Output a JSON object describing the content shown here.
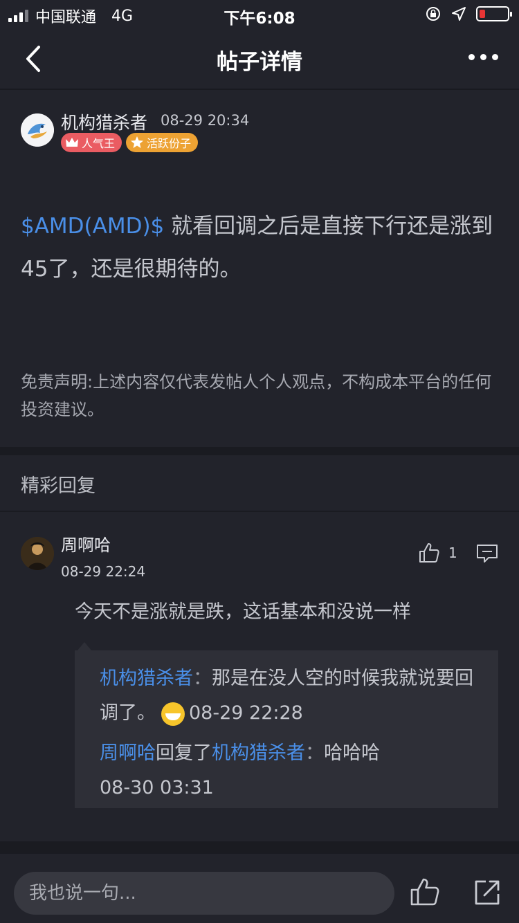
{
  "status_bar": {
    "carrier": "中国联通",
    "network": "4G",
    "time": "下午6:08",
    "battery_level": 0.2
  },
  "nav": {
    "title": "帖子详情"
  },
  "post": {
    "author": "机构猎杀者",
    "time": "08-29 20:34",
    "badges": [
      "人气王",
      "活跃份子"
    ],
    "stock_tag": "$AMD(AMD)$",
    "body": " 就看回调之后是直接下行还是涨到45了，还是很期待的。",
    "disclaimer": "免责声明:上述内容仅代表发帖人个人观点，不构成本平台的任何投资建议。"
  },
  "replies_section": {
    "title": "精彩回复"
  },
  "reply": {
    "author": "周啊哈",
    "time": "08-29 22:24",
    "like_count": "1",
    "text": "今天不是涨就是跌，这话基本和没说一样",
    "sub_replies": [
      {
        "author": "机构猎杀者",
        "separator": "：",
        "text": "那是在没人空的时候我就说要回调了。",
        "time": "08-29 22:28"
      },
      {
        "author": "周啊哈",
        "action": "回复了",
        "target": "机构猎杀者",
        "separator": "：",
        "text": "哈哈哈",
        "time": "08-30 03:31"
      }
    ]
  },
  "bottom_bar": {
    "input_placeholder": "我也说一句..."
  },
  "colors": {
    "background": "#22232b",
    "link": "#4a8fe8",
    "badge_red": "#ea5c62",
    "badge_orange": "#eda233"
  }
}
